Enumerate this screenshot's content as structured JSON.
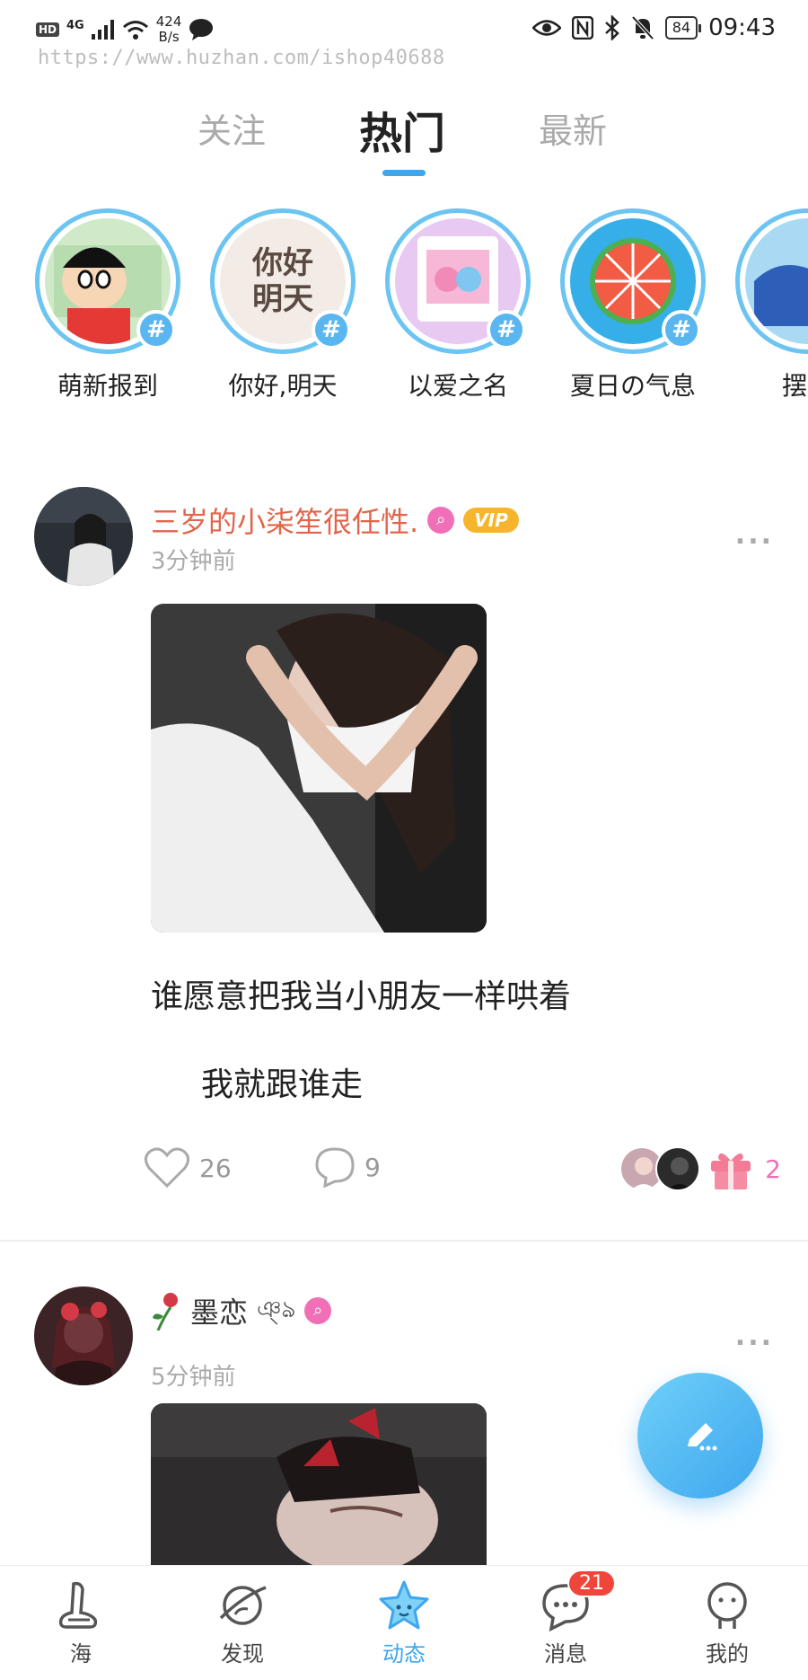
{
  "status_bar": {
    "hd": "HD",
    "network": "4G",
    "speed_value": "424",
    "speed_unit": "B/s",
    "battery": "84",
    "time": "09:43"
  },
  "watermark": "https://www.huzhan.com/ishop40688",
  "tabs": [
    {
      "label": "关注",
      "active": false
    },
    {
      "label": "热门",
      "active": true
    },
    {
      "label": "最新",
      "active": false
    }
  ],
  "topics": [
    {
      "label": "萌新报到"
    },
    {
      "label": "你好,明天",
      "image_text": "你好明天"
    },
    {
      "label": "以爱之名"
    },
    {
      "label": "夏日の气息"
    },
    {
      "label": "摆"
    }
  ],
  "posts": [
    {
      "author": "三岁的小柒笙很任性.",
      "vip_label": "VIP",
      "time": "3分钟前",
      "text_line1": "谁愿意把我当小朋友一样哄着",
      "text_line2": "我就跟谁走",
      "likes": "26",
      "comments": "9",
      "gifts": "2"
    },
    {
      "author": "墨恋",
      "time": "5分钟前"
    }
  ],
  "more_icon": "...",
  "nav": [
    {
      "label": "海",
      "icon": "sea-icon"
    },
    {
      "label": "发现",
      "icon": "planet-icon"
    },
    {
      "label": "动态",
      "icon": "star-icon",
      "active": true
    },
    {
      "label": "消息",
      "icon": "chat-icon",
      "badge": "21"
    },
    {
      "label": "我的",
      "icon": "profile-icon"
    }
  ],
  "colors": {
    "accent": "#3ea6ef",
    "author_name": "#e2654b",
    "vip": "#f7b52c",
    "badge": "#f0453a"
  }
}
